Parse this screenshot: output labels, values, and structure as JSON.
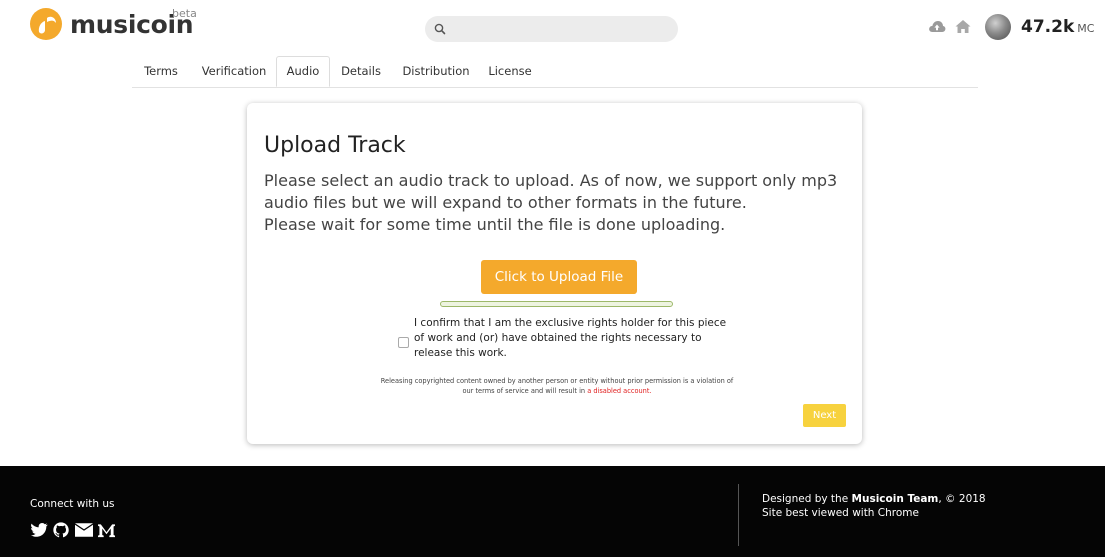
{
  "header": {
    "brand": "musicoin",
    "beta": "beta",
    "balance_value": "47.2k",
    "balance_unit": "MC",
    "accent_color": "#f4a92c"
  },
  "tabs": [
    "Terms",
    "Verification",
    "Audio",
    "Details",
    "Distribution",
    "License"
  ],
  "active_tab": "Audio",
  "card": {
    "title": "Upload Track",
    "desc1": "Please select an audio track to upload. As of now, we support only mp3 audio files but we will expand to other formats in the future.",
    "desc2": "Please wait for some time until the file is done uploading.",
    "upload_label": "Click to Upload File",
    "progress": 0,
    "confirm_text": "I confirm that I am the exclusive rights holder for this piece of work and (or) have obtained the rights necessary to release this work.",
    "warning_prefix": "Releasing copyrighted content owned by another person or entity without prior permission is a violation of our terms of service and will result in ",
    "warning_link": "a disabled account.",
    "next_label": "Next"
  },
  "footer": {
    "connect": "Connect with us",
    "designed_prefix": "Designed by the ",
    "designed_team": "Musicoin Team",
    "designed_suffix": ", © 2018",
    "best_viewed": "Site best viewed with Chrome",
    "social_icons": [
      "twitter-icon",
      "github-icon",
      "email-icon",
      "medium-icon"
    ]
  }
}
